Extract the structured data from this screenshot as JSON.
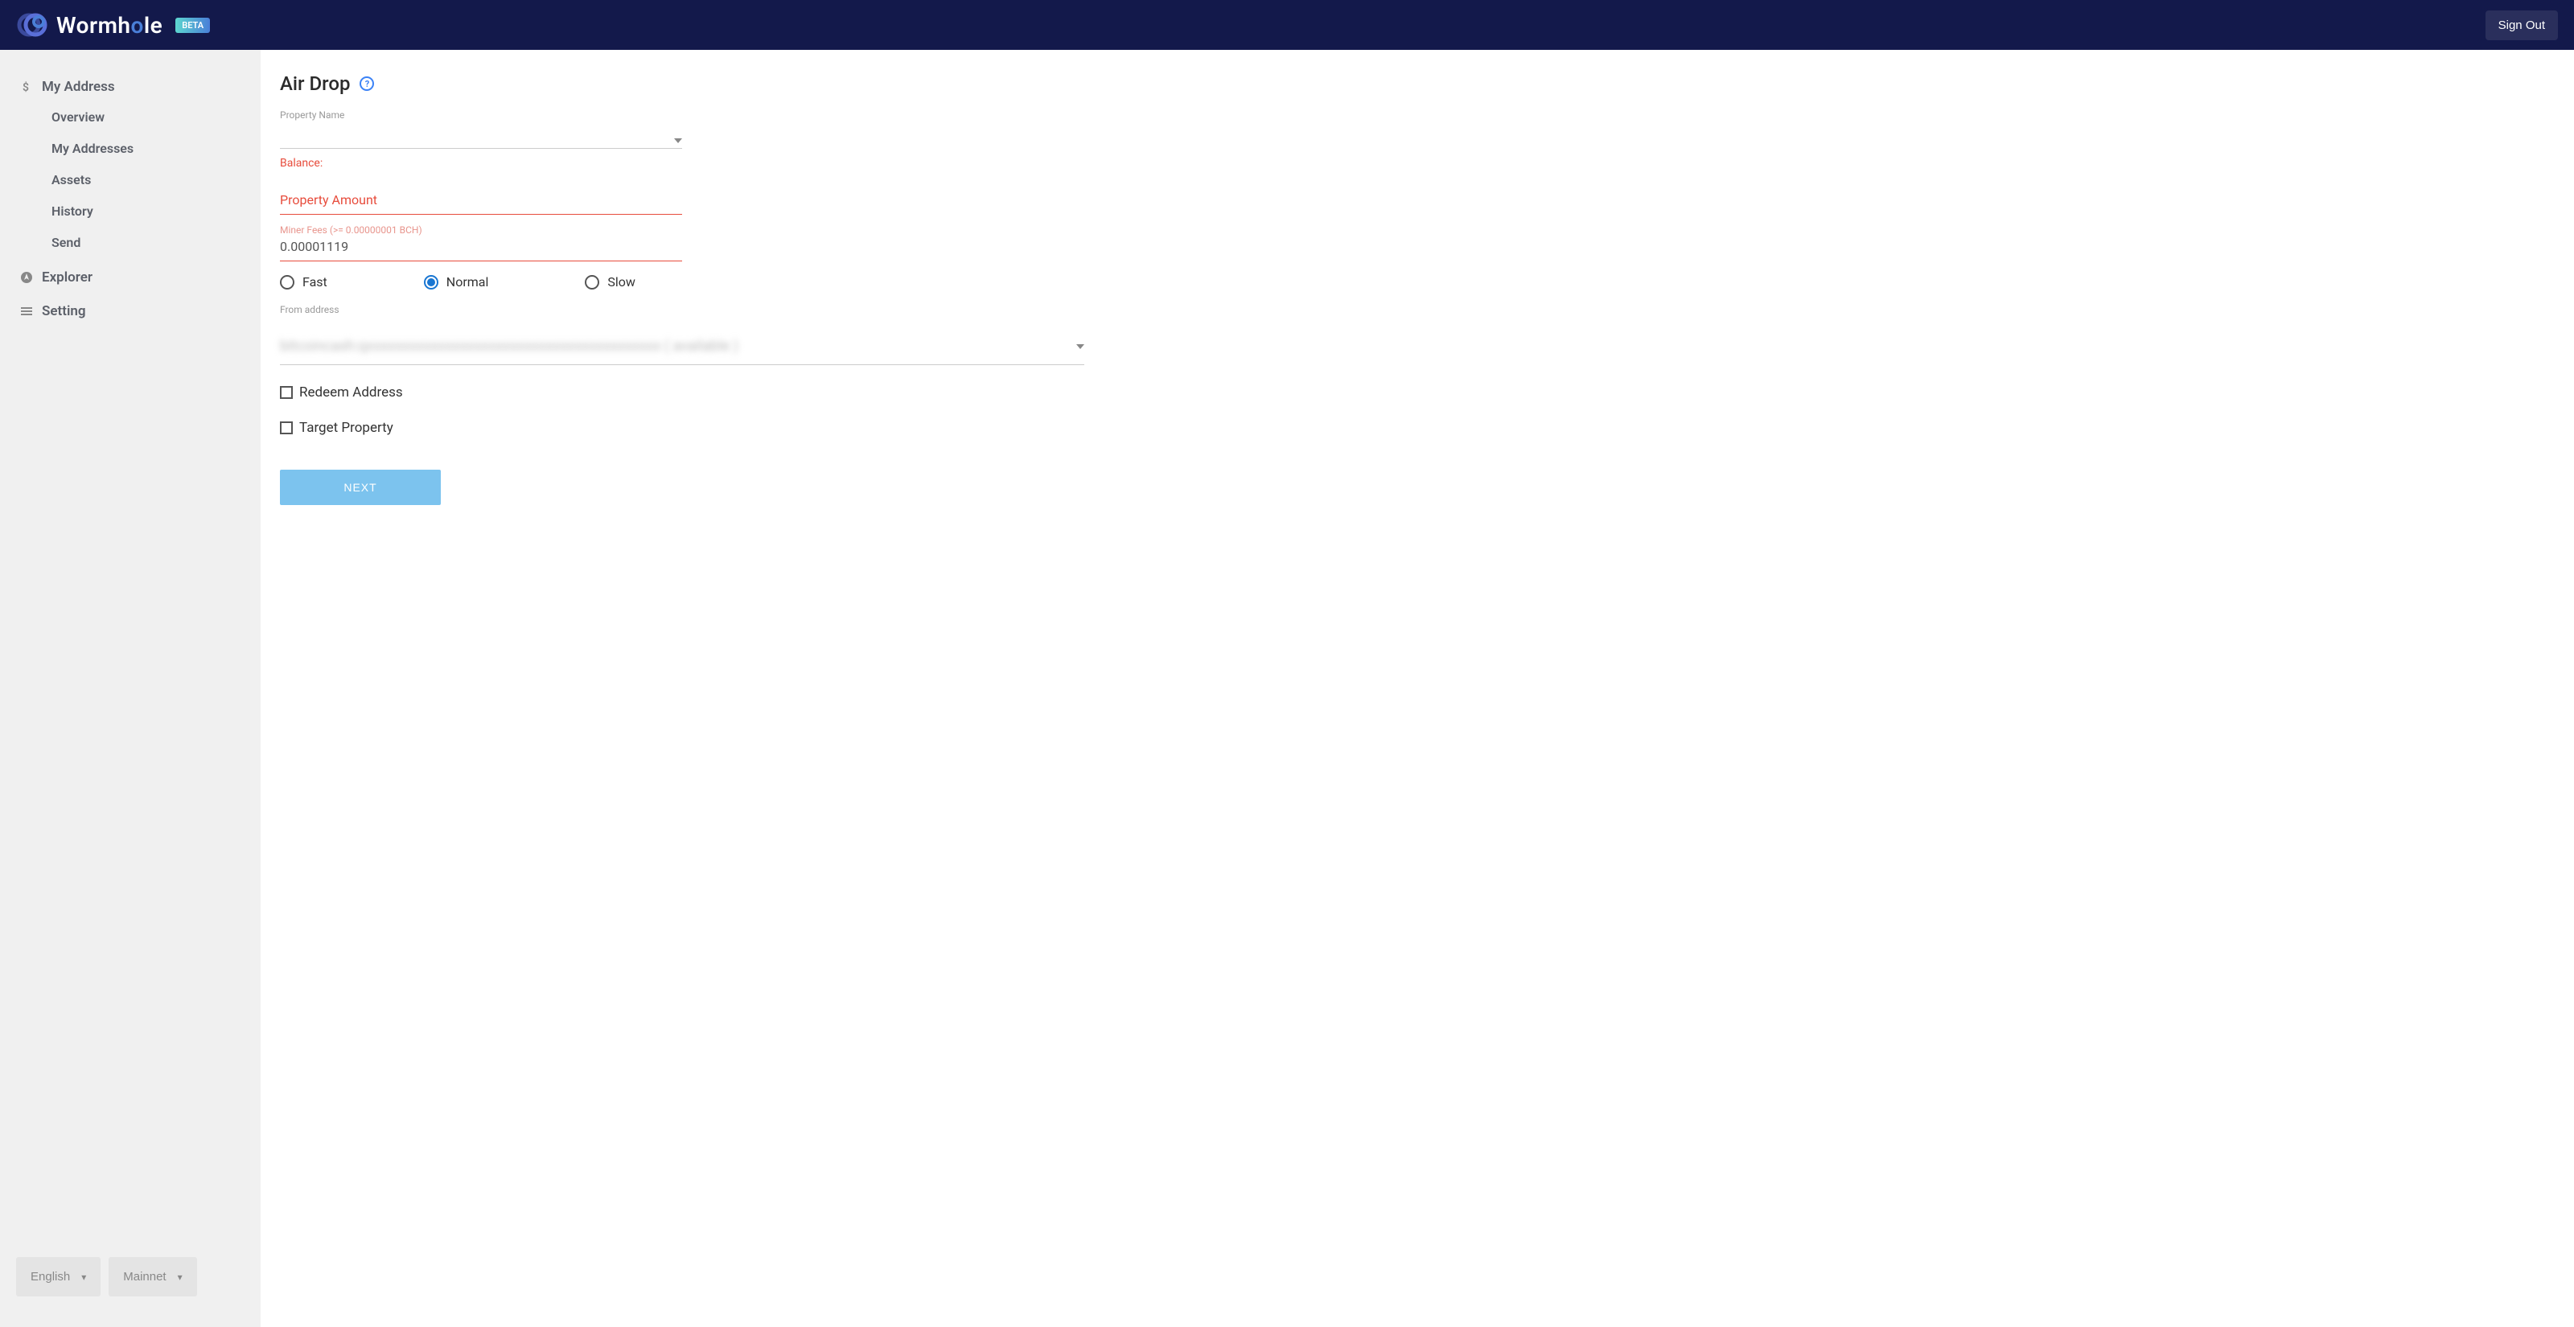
{
  "header": {
    "brand": "Wormhole",
    "badge": "BETA",
    "signout": "Sign Out"
  },
  "sidebar": {
    "sections": [
      {
        "icon": "dollar",
        "label": "My Address",
        "items": [
          "Overview",
          "My Addresses",
          "Assets",
          "History",
          "Send"
        ]
      },
      {
        "icon": "compass",
        "label": "Explorer"
      },
      {
        "icon": "menu",
        "label": "Setting"
      }
    ],
    "language": "English",
    "network": "Mainnet"
  },
  "main": {
    "title": "Air Drop",
    "property_name_label": "Property Name",
    "balance_label": "Balance:",
    "property_amount_label": "Property Amount",
    "miner_fees_label": "Miner Fees (>= 0.00000001 BCH)",
    "miner_fees_value": "0.00001119",
    "speed_options": [
      "Fast",
      "Normal",
      "Slow"
    ],
    "speed_selected": "Normal",
    "from_address_label": "From address",
    "from_address_value": "bitcoincash:qxxxxxxxxxxxxxxxxxxxxxxxxxxxxxxxxxxxxxxxxx ( available )",
    "redeem_label": "Redeem Address",
    "target_label": "Target Property",
    "next": "NEXT"
  }
}
